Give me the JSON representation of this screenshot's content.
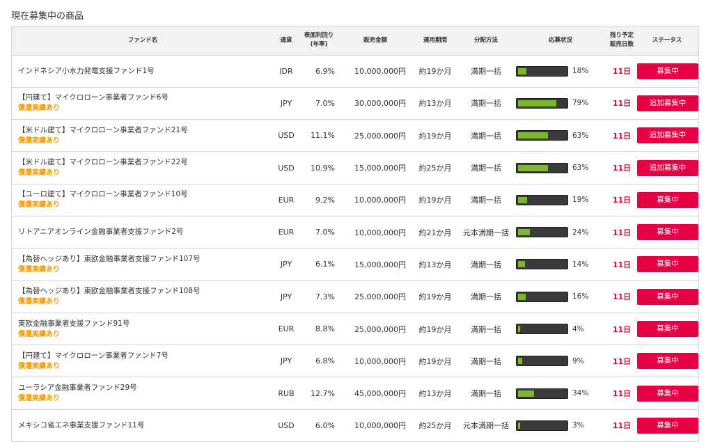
{
  "page_title": "現在募集中の商品",
  "table": {
    "headers": {
      "fund_name": "ファンド名",
      "currency": "通貨",
      "yield_line1": "表面利回り",
      "yield_line2": "(年率)",
      "amount": "販売金額",
      "period": "運用期間",
      "distribution": "分配方法",
      "progress": "応募状況",
      "remaining_line1": "残り予定",
      "remaining_line2": "販売日数",
      "status": "ステータス"
    },
    "rows": [
      {
        "name": "インドネシア小水力発電支援ファンド1号",
        "redeem": "",
        "currency": "IDR",
        "yield": "6.9%",
        "amount": "10,000,000円",
        "period": "約19か月",
        "distribution": "満期一括",
        "progress": 18,
        "progress_label": "18%",
        "days": "11日",
        "status": "募集中"
      },
      {
        "name": "【円建て】マイクロローン事業者ファンド6号",
        "redeem": "償還実績あり",
        "currency": "JPY",
        "yield": "7.0%",
        "amount": "30,000,000円",
        "period": "約13か月",
        "distribution": "満期一括",
        "progress": 79,
        "progress_label": "79%",
        "days": "11日",
        "status": "追加募集中"
      },
      {
        "name": "【米ドル建て】マイクロローン事業者ファンド21号",
        "redeem": "償還実績あり",
        "currency": "USD",
        "yield": "11.1%",
        "amount": "25,000,000円",
        "period": "約19か月",
        "distribution": "満期一括",
        "progress": 63,
        "progress_label": "63%",
        "days": "11日",
        "status": "追加募集中"
      },
      {
        "name": "【米ドル建て】マイクロローン事業者ファンド22号",
        "redeem": "償還実績あり",
        "currency": "USD",
        "yield": "10.9%",
        "amount": "15,000,000円",
        "period": "約25か月",
        "distribution": "満期一括",
        "progress": 63,
        "progress_label": "63%",
        "days": "11日",
        "status": "追加募集中"
      },
      {
        "name": "【ユーロ建て】マイクロローン事業者ファンド10号",
        "redeem": "償還実績あり",
        "currency": "EUR",
        "yield": "9.2%",
        "amount": "10,000,000円",
        "period": "約19か月",
        "distribution": "満期一括",
        "progress": 19,
        "progress_label": "19%",
        "days": "11日",
        "status": "募集中"
      },
      {
        "name": "リトアニアオンライン金融事業者支援ファンド2号",
        "redeem": "",
        "currency": "EUR",
        "yield": "7.0%",
        "amount": "10,000,000円",
        "period": "約21か月",
        "distribution": "元本満期一括",
        "progress": 24,
        "progress_label": "24%",
        "days": "11日",
        "status": "募集中"
      },
      {
        "name": "【為替ヘッジあり】東欧金融事業者支援ファンド107号",
        "redeem": "償還実績あり",
        "currency": "JPY",
        "yield": "6.1%",
        "amount": "15,000,000円",
        "period": "約13か月",
        "distribution": "満期一括",
        "progress": 14,
        "progress_label": "14%",
        "days": "11日",
        "status": "募集中"
      },
      {
        "name": "【為替ヘッジあり】東欧金融事業者支援ファンド108号",
        "redeem": "償還実績あり",
        "currency": "JPY",
        "yield": "7.3%",
        "amount": "25,000,000円",
        "period": "約19か月",
        "distribution": "満期一括",
        "progress": 16,
        "progress_label": "16%",
        "days": "11日",
        "status": "募集中"
      },
      {
        "name": "東欧金融事業者支援ファンド91号",
        "redeem": "償還実績あり",
        "currency": "EUR",
        "yield": "8.8%",
        "amount": "25,000,000円",
        "period": "約19か月",
        "distribution": "満期一括",
        "progress": 4,
        "progress_label": "4%",
        "days": "11日",
        "status": "募集中"
      },
      {
        "name": "【円建て】マイクロローン事業者ファンド7号",
        "redeem": "償還実績あり",
        "currency": "JPY",
        "yield": "6.8%",
        "amount": "10,000,000円",
        "period": "約19か月",
        "distribution": "満期一括",
        "progress": 9,
        "progress_label": "9%",
        "days": "11日",
        "status": "募集中"
      },
      {
        "name": "ユーラシア金融事業者ファンド29号",
        "redeem": "償還実績あり",
        "currency": "RUB",
        "yield": "12.7%",
        "amount": "45,000,000円",
        "period": "約13か月",
        "distribution": "満期一括",
        "progress": 34,
        "progress_label": "34%",
        "days": "11日",
        "status": "募集中"
      },
      {
        "name": "メキシコ省エネ事業支援ファンド11号",
        "redeem": "",
        "currency": "USD",
        "yield": "6.0%",
        "amount": "10,000,000円",
        "period": "約25か月",
        "distribution": "元本満期一括",
        "progress": 3,
        "progress_label": "3%",
        "days": "11日",
        "status": "募集中"
      }
    ]
  },
  "colors": {
    "redeem_text": "#f39800",
    "status_button": "#e60044",
    "days_text": "#e60033",
    "bar_fill": "#7cb82f",
    "bar_track": "#3a3a3a"
  }
}
